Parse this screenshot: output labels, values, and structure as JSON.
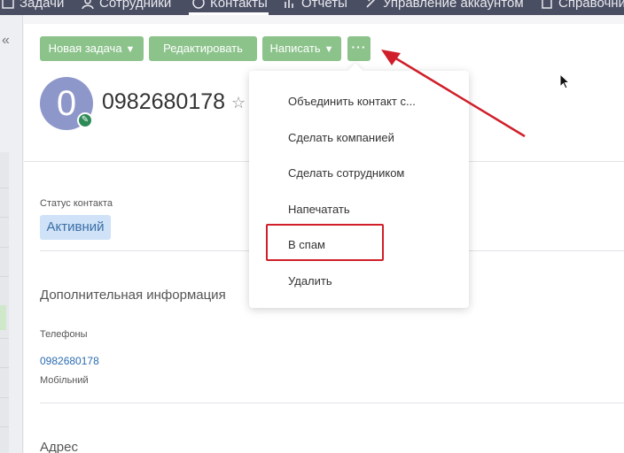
{
  "nav": {
    "items": [
      {
        "label": "Задачи",
        "icon": "tasks-icon"
      },
      {
        "label": "Сотрудники",
        "icon": "employees-icon"
      },
      {
        "label": "Контакты",
        "icon": "contacts-icon"
      },
      {
        "label": "Отчеты",
        "icon": "reports-icon"
      },
      {
        "label": "Управление аккаунтом",
        "icon": "account-settings-icon"
      },
      {
        "label": "Справочни",
        "icon": "directory-icon"
      }
    ],
    "active": "Контакты"
  },
  "sidebar": {
    "collapse_glyph": "«"
  },
  "toolbar": {
    "new_task": "Новая задача",
    "edit": "Редактировать",
    "write": "Написать",
    "more": "···"
  },
  "contact": {
    "avatar_letter": "0",
    "name": "0982680178"
  },
  "fields": {
    "status_label": "Статус контакта",
    "status_value": "Активний",
    "additional_info_title": "Дополнительная информация",
    "phones_label": "Телефоны",
    "phone_value": "0982680178",
    "phone_type": "Мобільний",
    "address_title": "Адрес"
  },
  "menu": {
    "items": [
      "Объединить контакт с...",
      "Сделать компанией",
      "Сделать сотрудником",
      "Напечатать",
      "В спам",
      "Удалить"
    ]
  },
  "colors": {
    "nav_bg": "#4a4e63",
    "button_green": "#8cc38b",
    "avatar": "#8e97c9",
    "status_badge": "#cfe2f7",
    "annotation_red": "#d01f2a",
    "link": "#2b6cb0"
  }
}
